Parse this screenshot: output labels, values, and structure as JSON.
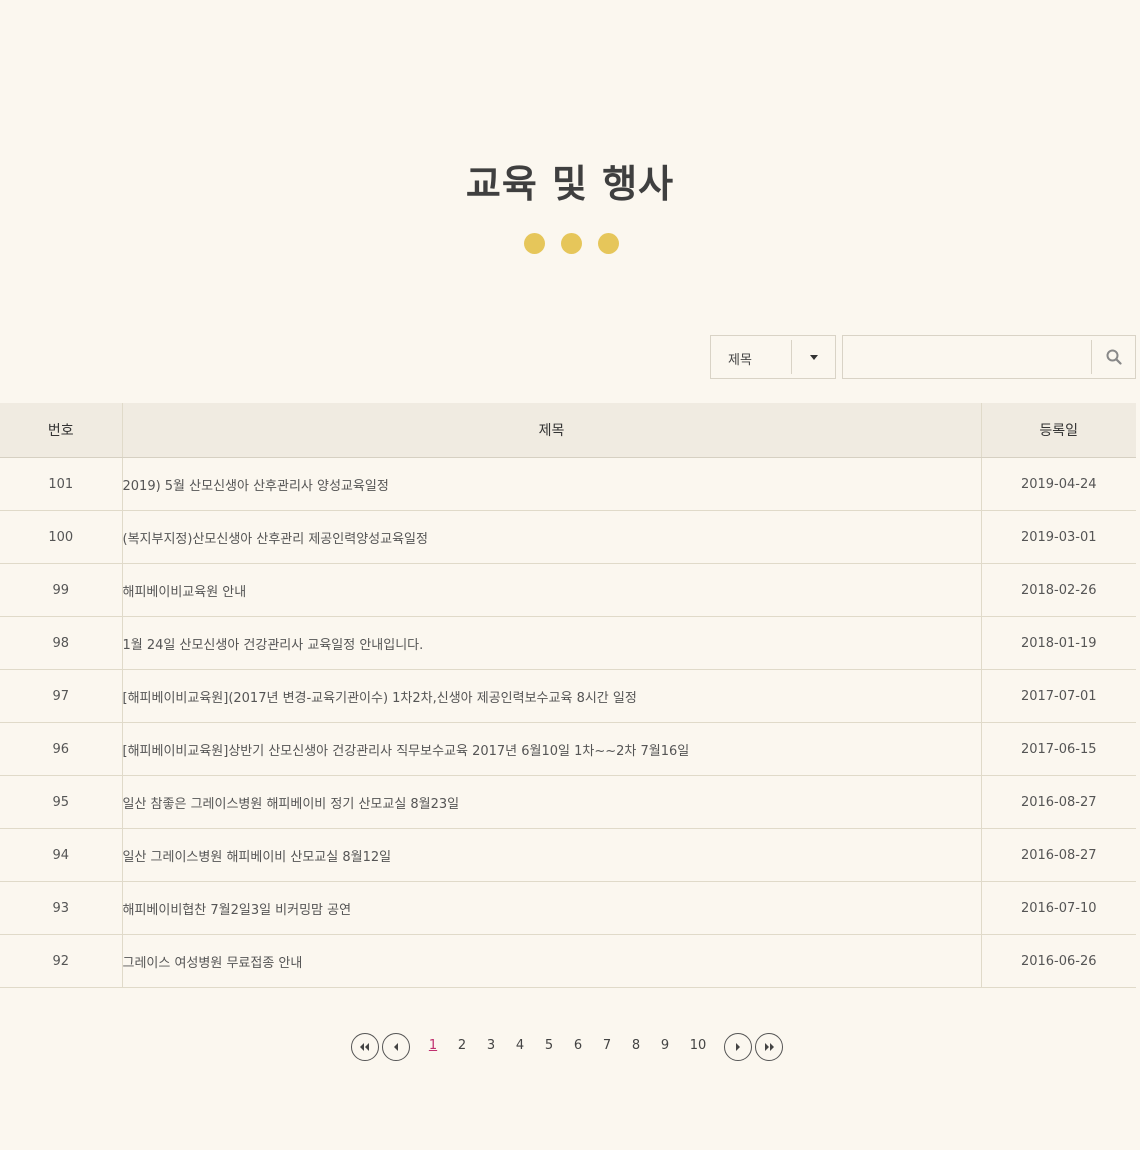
{
  "header": {
    "title": "교육 및 행사"
  },
  "search": {
    "field_selected": "제목",
    "query": "",
    "placeholder": ""
  },
  "table": {
    "columns": {
      "number": "번호",
      "title": "제목",
      "date": "등록일"
    },
    "rows": [
      {
        "number": "101",
        "title": "2019) 5월 산모신생아 산후관리사 양성교육일정",
        "date": "2019-04-24"
      },
      {
        "number": "100",
        "title": "(복지부지정)산모신생아 산후관리 제공인력양성교육일정",
        "date": "2019-03-01"
      },
      {
        "number": "99",
        "title": "해피베이비교육원 안내",
        "date": "2018-02-26"
      },
      {
        "number": "98",
        "title": "1월 24일 산모신생아 건강관리사 교육일정 안내입니다.",
        "date": "2018-01-19"
      },
      {
        "number": "97",
        "title": "[해피베이비교육원](2017년 변경-교육기관이수) 1차2차,신생아 제공인력보수교육 8시간 일정",
        "date": "2017-07-01"
      },
      {
        "number": "96",
        "title": "[해피베이비교육원]상반기 산모신생아 건강관리사 직무보수교육 2017년 6월10일 1차~~2차 7월16일",
        "date": "2017-06-15"
      },
      {
        "number": "95",
        "title": "일산 참좋은 그레이스병원 해피베이비 정기 산모교실 8월23일",
        "date": "2016-08-27"
      },
      {
        "number": "94",
        "title": "일산 그레이스병원 해피베이비 산모교실 8월12일",
        "date": "2016-08-27"
      },
      {
        "number": "93",
        "title": "해피베이비협찬 7월2일3일 비커밍맘 공연",
        "date": "2016-07-10"
      },
      {
        "number": "92",
        "title": "그레이스 여성병원 무료접종 안내",
        "date": "2016-06-26"
      }
    ]
  },
  "pagination": {
    "current": 1,
    "pages": [
      "1",
      "2",
      "3",
      "4",
      "5",
      "6",
      "7",
      "8",
      "9",
      "10"
    ]
  },
  "colors": {
    "accent_dot": "#e6c65a",
    "active_page": "#c0306f",
    "background": "#fbf7ef"
  }
}
